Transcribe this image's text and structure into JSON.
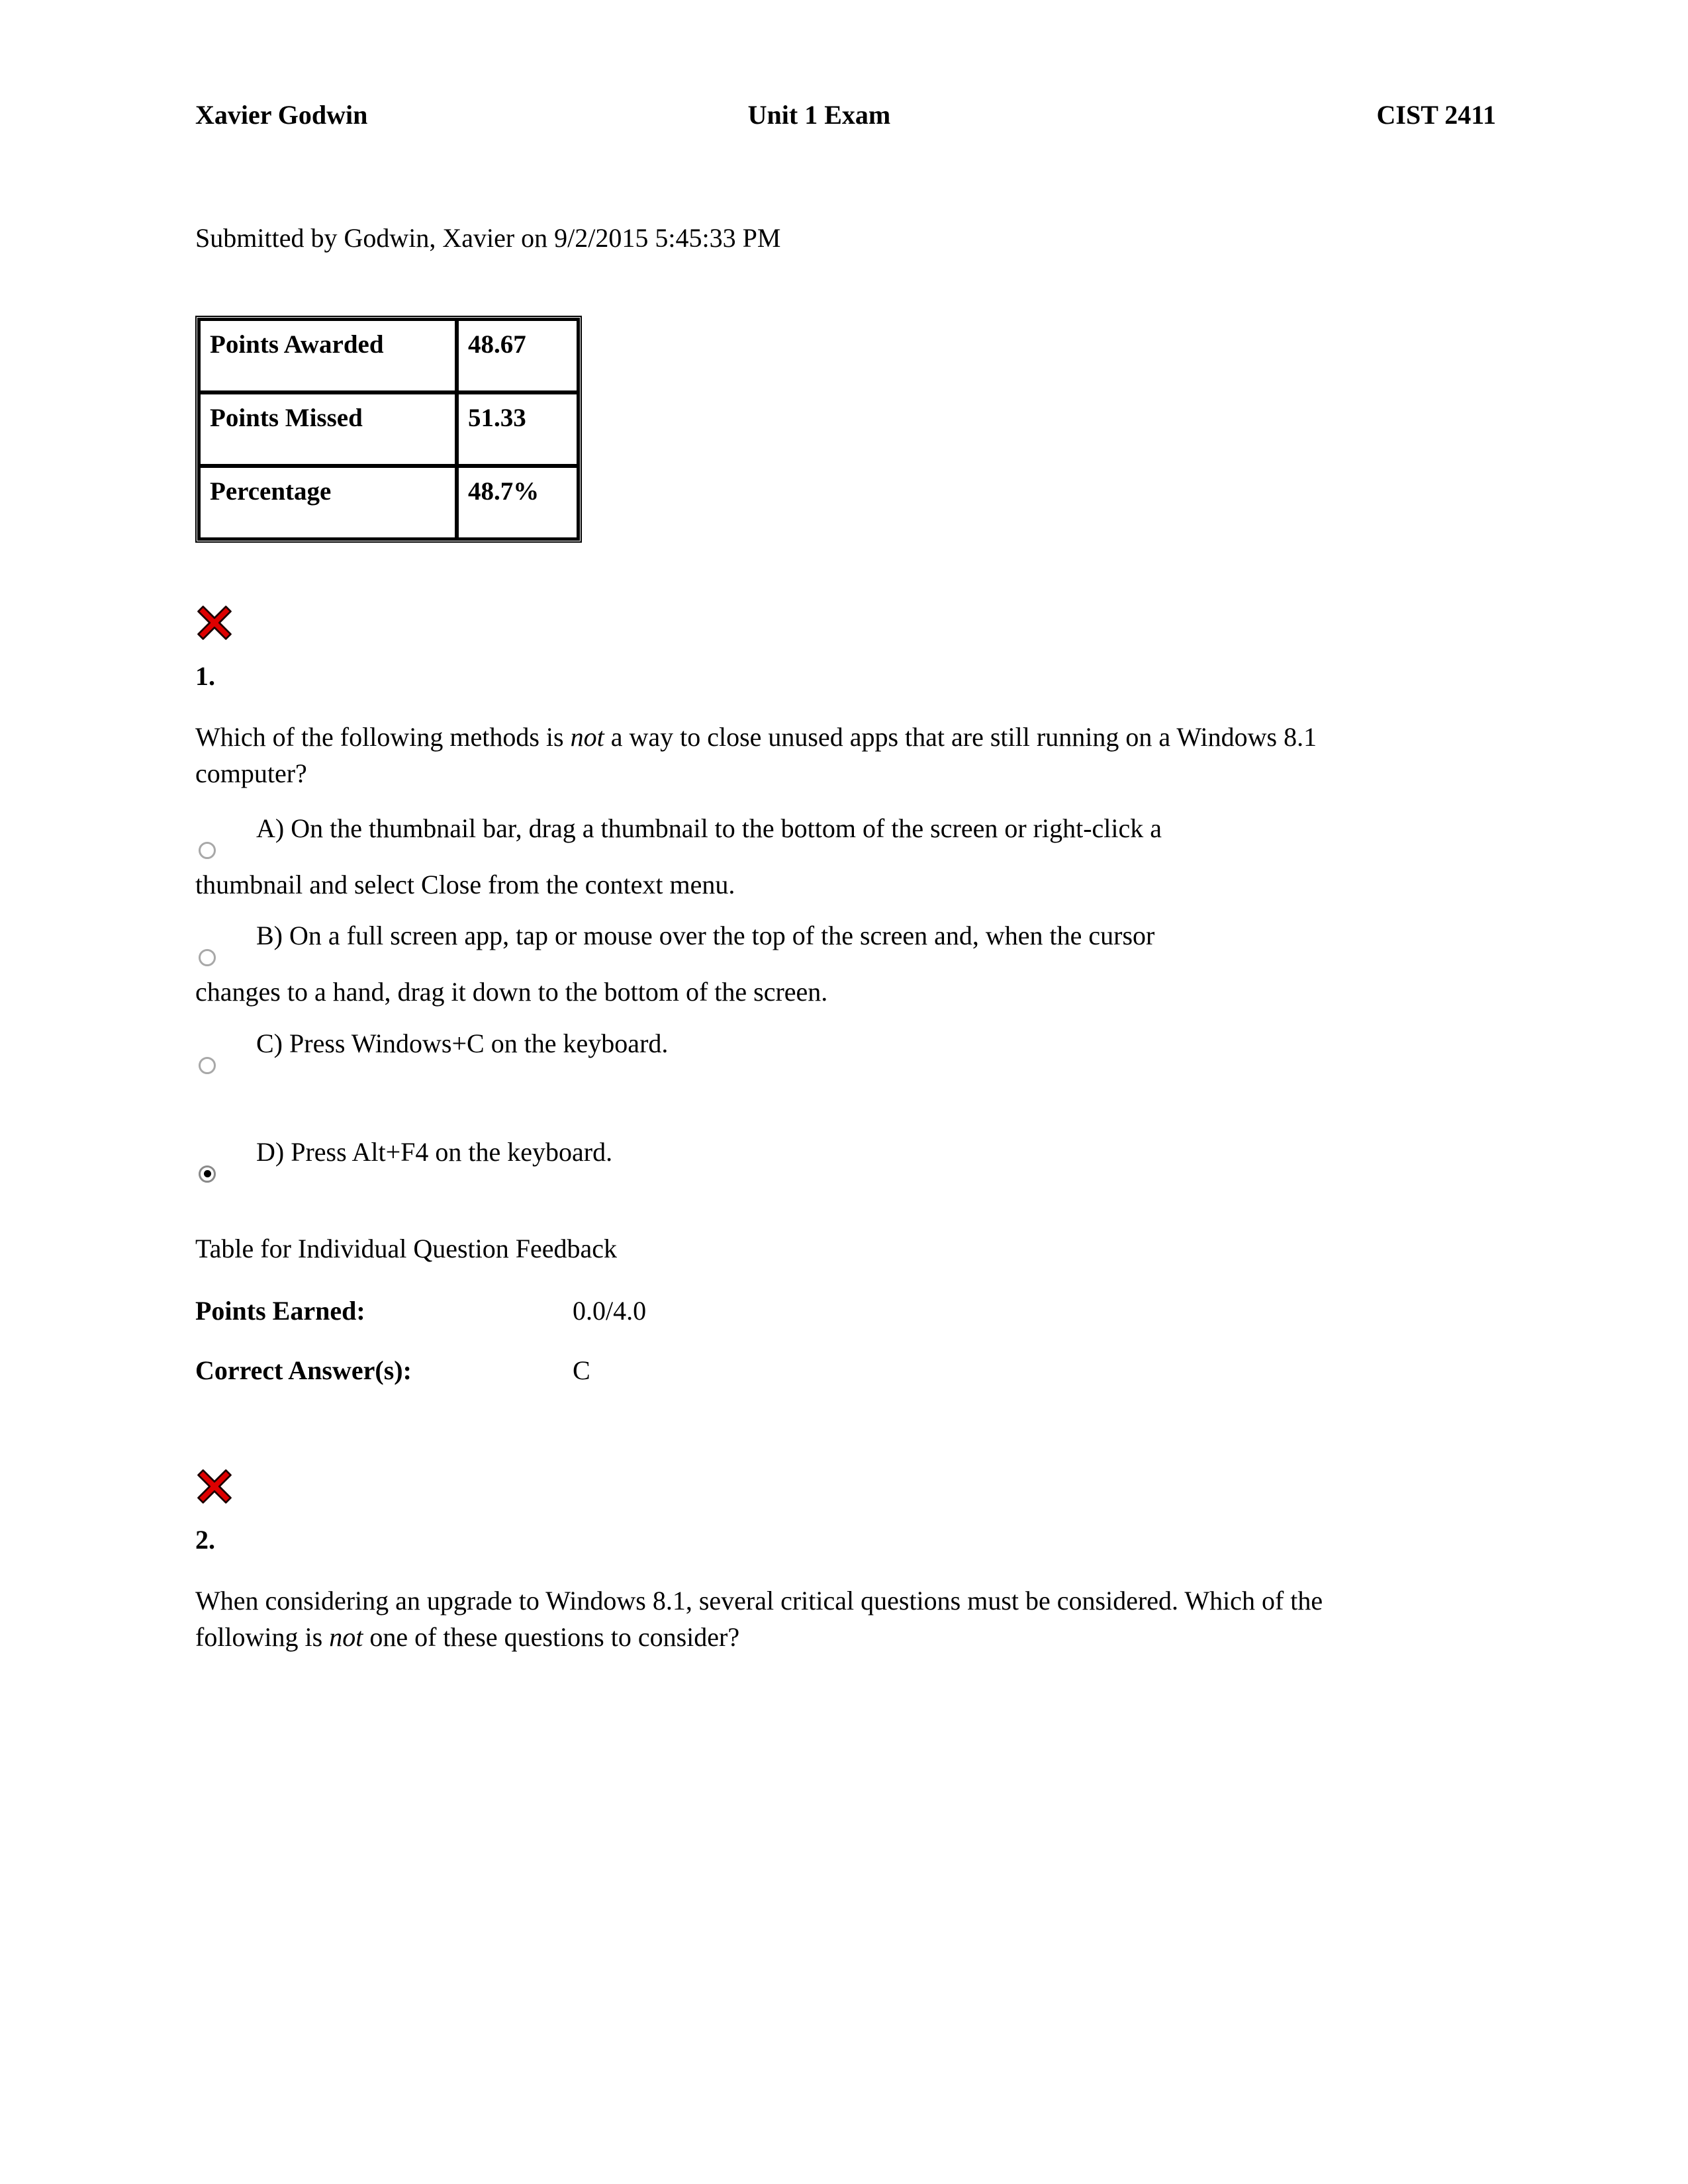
{
  "header": {
    "student_name": "Xavier Godwin",
    "exam_title": "Unit 1 Exam",
    "course_code": "CIST 2411"
  },
  "submission": {
    "line": "Submitted by Godwin, Xavier on 9/2/2015 5:45:33 PM"
  },
  "score_table": {
    "rows": [
      {
        "label": "Points Awarded",
        "value": "48.67"
      },
      {
        "label": "Points Missed",
        "value": "51.33"
      },
      {
        "label": "Percentage",
        "value": "48.7%"
      }
    ]
  },
  "icons": {
    "incorrect_mark": "red-x-mark-icon",
    "incorrect_color": "#DD0000"
  },
  "questions": [
    {
      "number": "1.",
      "result": "incorrect",
      "text_part1": "Which of the following methods is ",
      "text_italic": "not",
      "text_part2": " a way to close unused apps that are still running on a Windows 8.1 computer?",
      "options": [
        {
          "letter": "A)",
          "text": "A) On the thumbnail bar, drag a thumbnail to the bottom of the screen or right-click a",
          "continuation": "thumbnail and select Close from the context menu.",
          "selected": false
        },
        {
          "letter": "B)",
          "text": "B) On a full screen app, tap or mouse over the top of the screen and, when the cursor",
          "continuation": "changes to a hand, drag it down to the bottom of the screen.",
          "selected": false
        },
        {
          "letter": "C)",
          "text": "C) Press Windows+C on the keyboard.",
          "continuation": "",
          "selected": false
        },
        {
          "letter": "D)",
          "text": "D) Press Alt+F4 on the keyboard.",
          "continuation": "",
          "selected": true
        }
      ],
      "feedback": {
        "title": "Table for Individual Question Feedback",
        "points_earned_label": "Points Earned:",
        "points_earned_value": "0.0/4.0",
        "correct_answer_label": "Correct Answer(s):",
        "correct_answer_value": "C"
      }
    },
    {
      "number": "2.",
      "result": "incorrect",
      "text_part1": "When considering an upgrade to Windows 8.1, several critical questions must be considered. Which of the following is ",
      "text_italic": "not",
      "text_part2": " one of these questions to consider?"
    }
  ]
}
